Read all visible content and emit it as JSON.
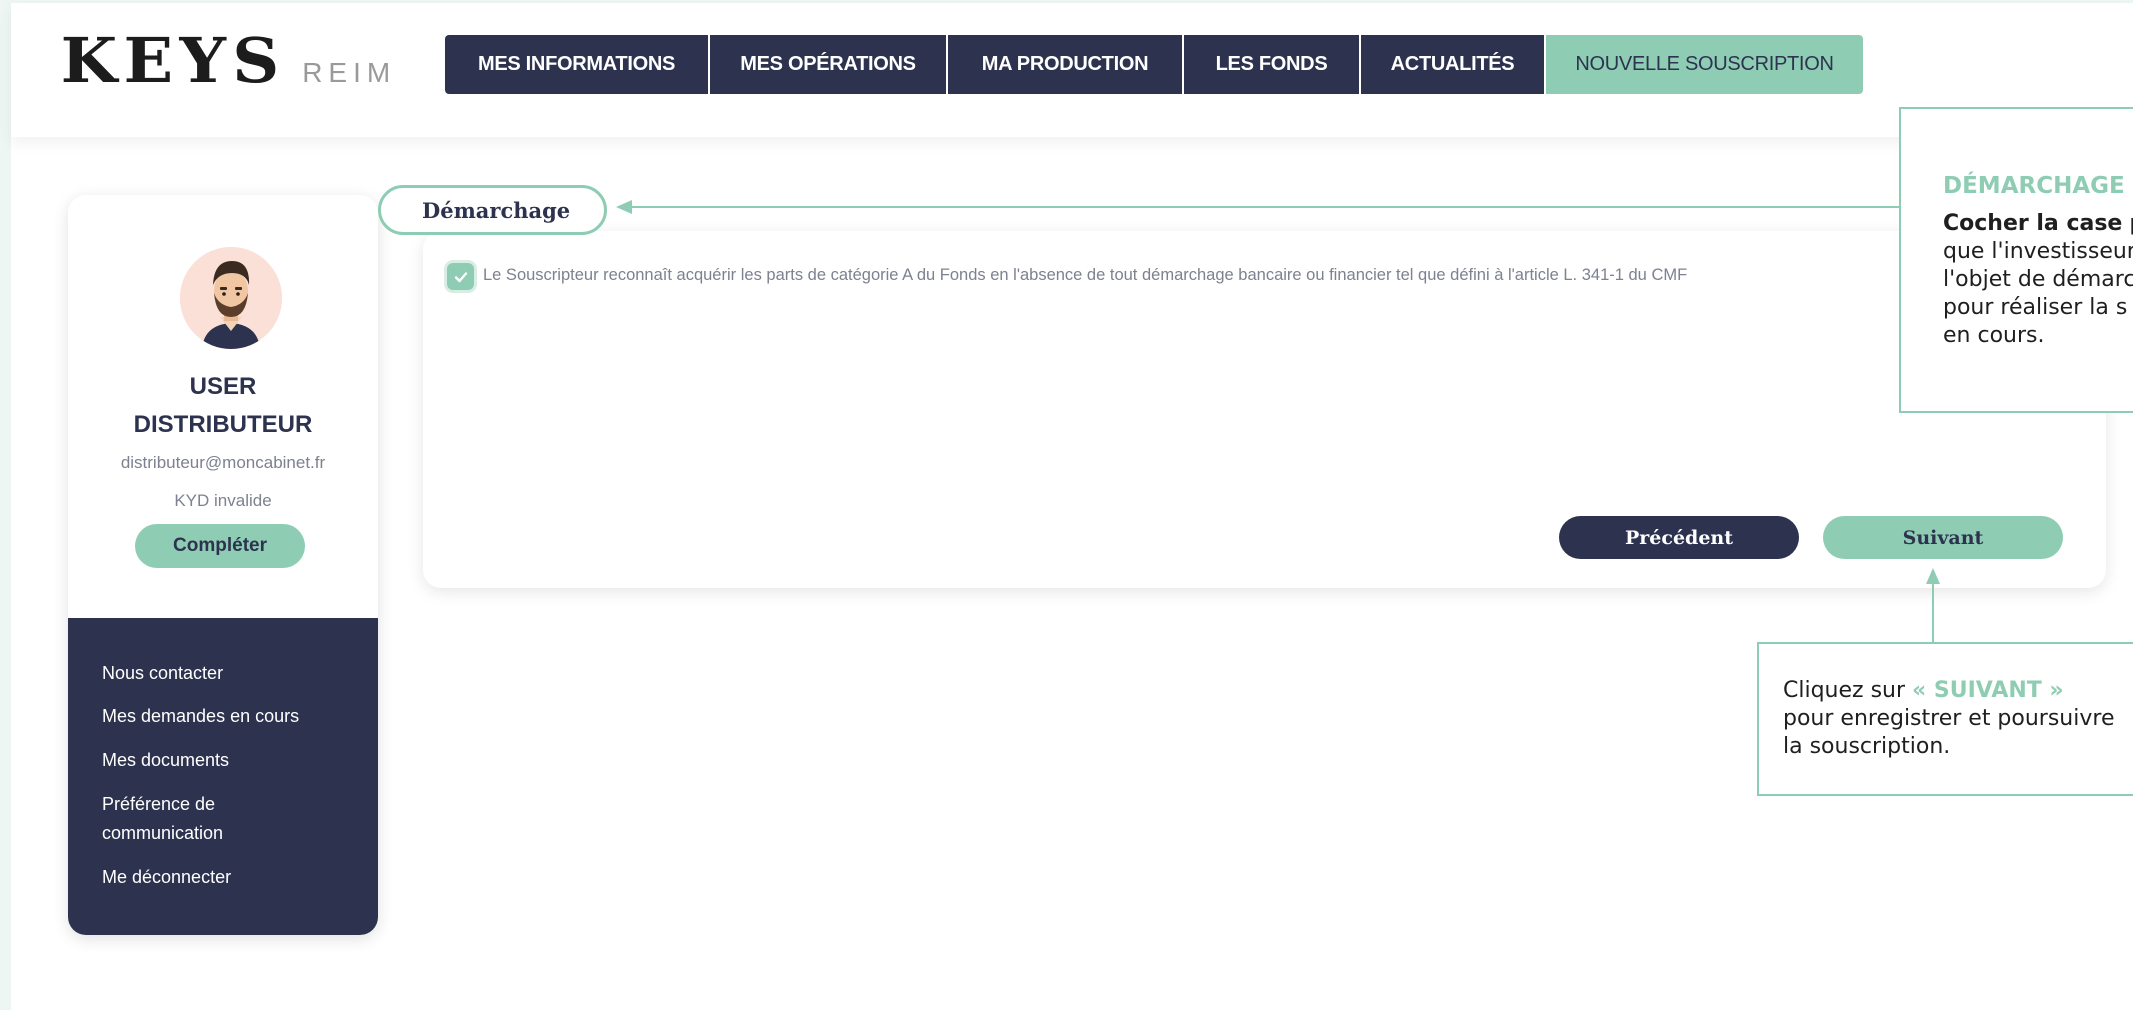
{
  "logo": {
    "main": "KEYS",
    "sub": "REIM"
  },
  "nav": {
    "items": [
      {
        "label": "MES INFORMATIONS",
        "active": false
      },
      {
        "label": "MES OPÉRATIONS",
        "active": false
      },
      {
        "label": "MA PRODUCTION",
        "active": false
      },
      {
        "label": "LES FONDS",
        "active": false
      },
      {
        "label": "ACTUALITÉS",
        "active": false
      },
      {
        "label": "NOUVELLE SOUSCRIPTION",
        "active": true
      }
    ]
  },
  "user": {
    "name_line1": "USER",
    "name_line2": "DISTRIBUTEUR",
    "email": "distributeur@moncabinet.fr",
    "kyd_status": "KYD invalide",
    "complete_label": "Compléter"
  },
  "side_menu": {
    "items": [
      "Nous contacter",
      "Mes demandes en cours",
      "Mes documents",
      "Préférence de",
      "communication",
      "Me déconnecter"
    ]
  },
  "form": {
    "section_title": "Démarchage",
    "checkbox_checked": true,
    "checkbox_label": "Le Souscripteur reconnaît acquérir les parts de catégorie A du Fonds en l'absence de tout démarchage bancaire ou financier tel que défini à l'article L. 341-1 du CMF",
    "prev_label": "Précédent",
    "next_label": "Suivant"
  },
  "annotations": {
    "demarchage": {
      "title": "DÉMARCHAGE :",
      "bold": "Cocher la case",
      "text_1": " po",
      "line_2": "que l'investisseur",
      "line_3": "l'objet de démarc",
      "line_4": "pour réaliser la s",
      "line_5": "en cours."
    },
    "suivant": {
      "prefix": "Cliquez sur ",
      "highlight": "« SUIVANT »",
      "line_2": "pour enregistrer et poursuivre",
      "line_3": "la souscription."
    }
  },
  "colors": {
    "navy": "#2d334f",
    "mint": "#8ecdb3",
    "background": "#eef6f4"
  }
}
